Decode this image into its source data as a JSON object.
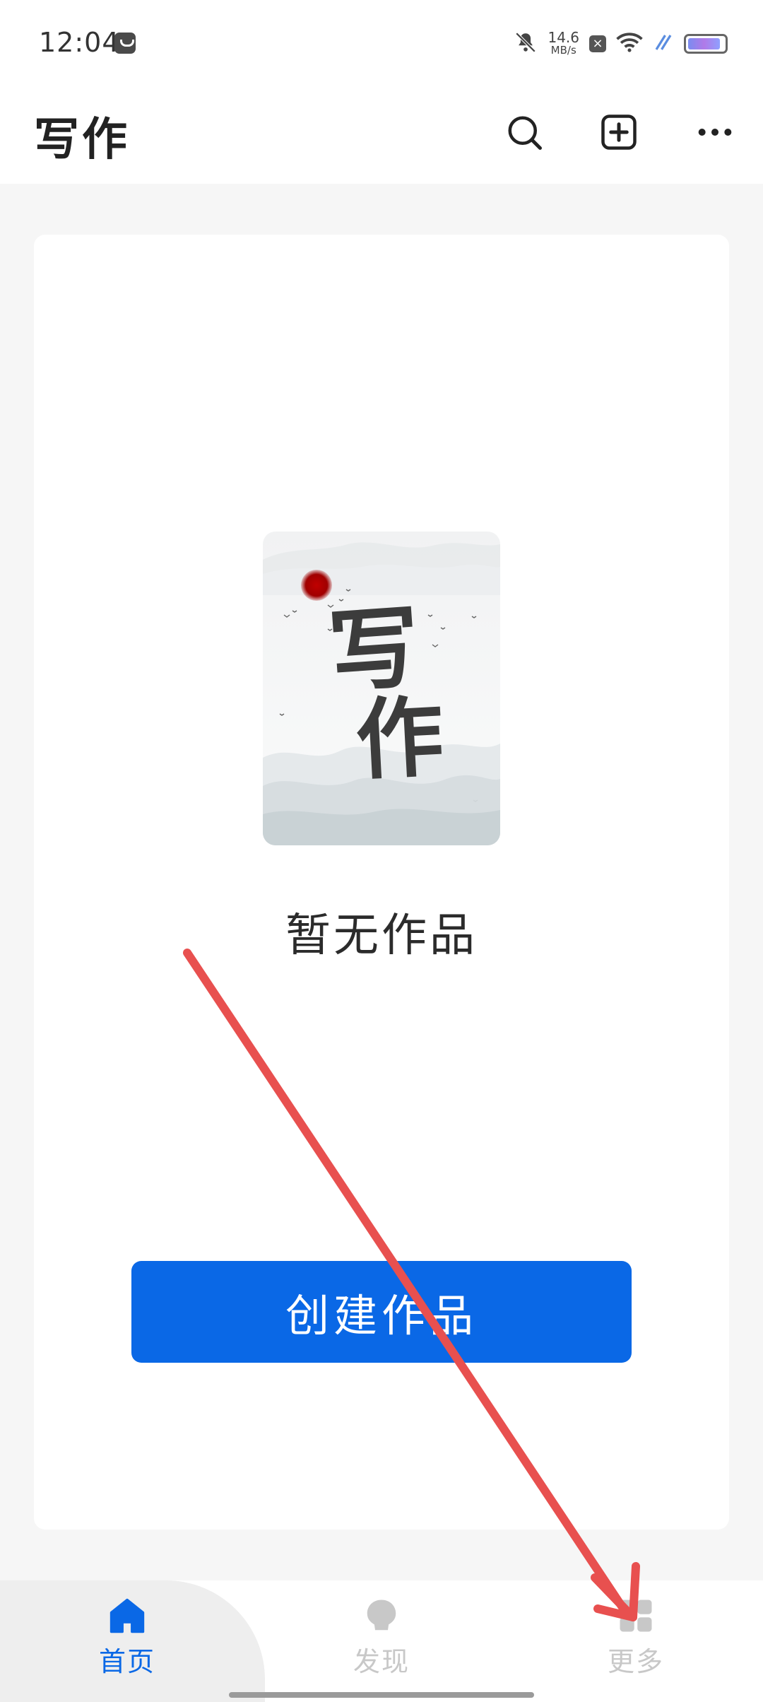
{
  "status_bar": {
    "time": "12:04",
    "net_speed_value": "14.6",
    "net_speed_unit": "MB/s",
    "battery_level": 0.9,
    "icons": [
      "notification-app-icon",
      "bell-muted-icon",
      "close-badge-icon",
      "wifi-icon",
      "charging-icon",
      "battery-icon"
    ]
  },
  "app_bar": {
    "title": "写作",
    "actions": [
      "search-icon",
      "add-square-icon",
      "more-dots-icon"
    ]
  },
  "content": {
    "illustration": {
      "calligraphy_top": "写",
      "calligraphy_bottom": "作",
      "sun_color": "#b30000"
    },
    "empty_message": "暂无作品",
    "create_button_label": "创建作品"
  },
  "bottom_nav": {
    "items": [
      {
        "label": "首页",
        "icon": "home-icon",
        "active": true
      },
      {
        "label": "发现",
        "icon": "discover-bulb-icon",
        "active": false
      },
      {
        "label": "更多",
        "icon": "grid-more-icon",
        "active": false
      }
    ]
  },
  "colors": {
    "primary": "#0a68e6",
    "inactive": "#c8c8c8",
    "annotation_arrow": "#e8504f"
  }
}
